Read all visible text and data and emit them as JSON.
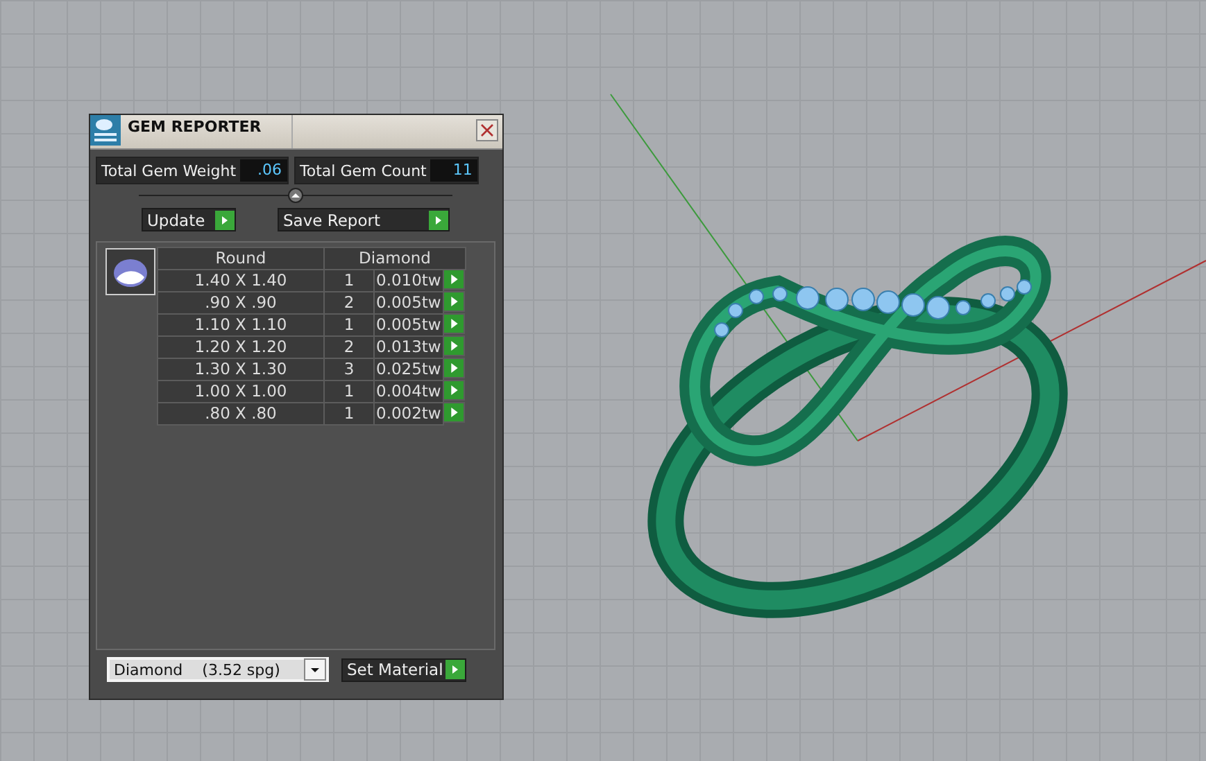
{
  "window": {
    "title": "GEM REPORTER"
  },
  "totals": [
    {
      "label": "Total Gem Weight",
      "value": ".06"
    },
    {
      "label": "Total Gem Count",
      "value": "11"
    }
  ],
  "actions": [
    {
      "label": "Update"
    },
    {
      "label": "Save Report"
    }
  ],
  "table": {
    "columns": [
      "Round",
      "Diamond"
    ],
    "rows": [
      {
        "size": "1.40 X 1.40",
        "count": "1",
        "weight": "0.010tw"
      },
      {
        "size": ".90 X .90",
        "count": "2",
        "weight": "0.005tw"
      },
      {
        "size": "1.10 X 1.10",
        "count": "1",
        "weight": "0.005tw"
      },
      {
        "size": "1.20 X 1.20",
        "count": "2",
        "weight": "0.013tw"
      },
      {
        "size": "1.30 X 1.30",
        "count": "3",
        "weight": "0.025tw"
      },
      {
        "size": "1.00 X 1.00",
        "count": "1",
        "weight": "0.004tw"
      },
      {
        "size": ".80 X .80",
        "count": "1",
        "weight": "0.002tw"
      }
    ]
  },
  "material": {
    "value": "Diamond    (3.52 spg)",
    "button": "Set Material"
  }
}
